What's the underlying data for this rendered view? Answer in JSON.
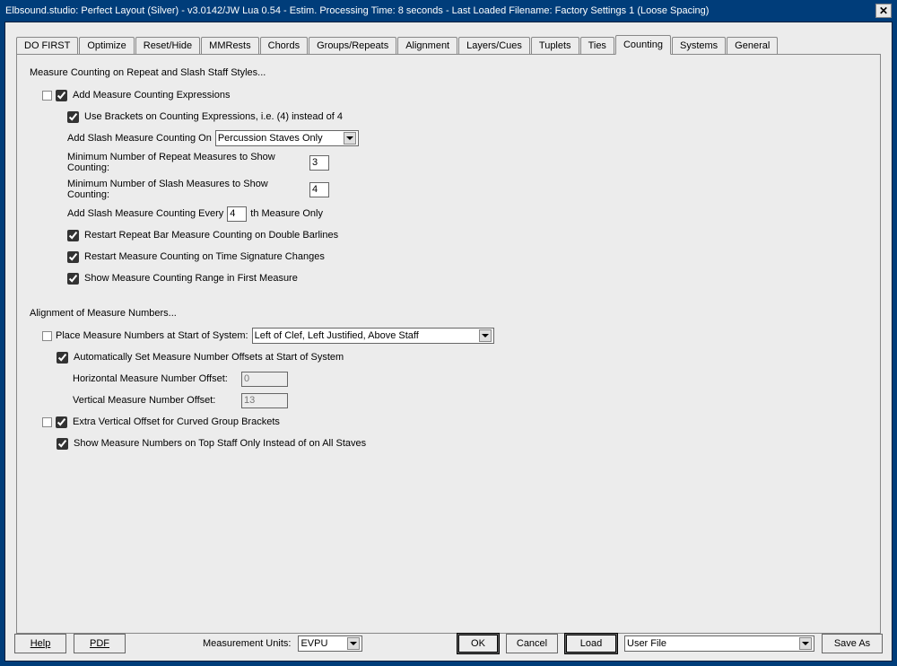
{
  "window": {
    "title": "Elbsound.studio: Perfect Layout (Silver) - v3.0142/JW Lua 0.54 - Estim. Processing Time: 8 seconds - Last Loaded Filename: Factory Settings 1 (Loose Spacing)"
  },
  "tabs": [
    {
      "label": "DO FIRST"
    },
    {
      "label": "Optimize"
    },
    {
      "label": "Reset/Hide"
    },
    {
      "label": "MMRests"
    },
    {
      "label": "Chords"
    },
    {
      "label": "Groups/Repeats"
    },
    {
      "label": "Alignment"
    },
    {
      "label": "Layers/Cues"
    },
    {
      "label": "Tuplets"
    },
    {
      "label": "Ties"
    },
    {
      "label": "Counting"
    },
    {
      "label": "Systems"
    },
    {
      "label": "General"
    }
  ],
  "section1": {
    "heading": "Measure Counting on Repeat and Slash Staff Styles...",
    "addCounting": "Add Measure Counting Expressions",
    "useBrackets": "Use Brackets on Counting Expressions, i.e. (4) instead of 4",
    "addSlashOnLabel": "Add Slash Measure Counting On",
    "addSlashOnValue": "Percussion Staves Only",
    "minRepeatLabel": "Minimum Number of Repeat Measures to Show Counting:",
    "minRepeatValue": "3",
    "minSlashLabel": "Minimum Number of Slash Measures to Show Counting:",
    "minSlashValue": "4",
    "everyLabelA": "Add Slash Measure Counting Every",
    "everyValue": "4",
    "everyLabelB": "th Measure Only",
    "restartDouble": "Restart Repeat Bar Measure Counting on Double Barlines",
    "restartTime": "Restart Measure Counting on Time Signature Changes",
    "showRange": "Show Measure Counting Range in First Measure"
  },
  "section2": {
    "heading": "Alignment of Measure Numbers...",
    "placeLabel": "Place Measure Numbers at Start of System:",
    "placeValue": "Left of Clef, Left Justified, Above Staff",
    "autoOffset": "Automatically Set Measure Number Offsets at Start of System",
    "horizLabel": "Horizontal Measure Number Offset:",
    "horizValue": "0",
    "vertLabel": "Vertical Measure Number Offset:",
    "vertValue": "13",
    "extraVert": "Extra Vertical Offset for Curved Group Brackets",
    "topStaff": "Show Measure Numbers on Top Staff Only Instead of on All Staves"
  },
  "footer": {
    "help": "Help",
    "pdf": "PDF",
    "unitsLabel": "Measurement Units:",
    "unitsValue": "EVPU",
    "ok": "OK",
    "cancel": "Cancel",
    "load": "Load",
    "fileValue": "User File",
    "saveAs": "Save As"
  }
}
